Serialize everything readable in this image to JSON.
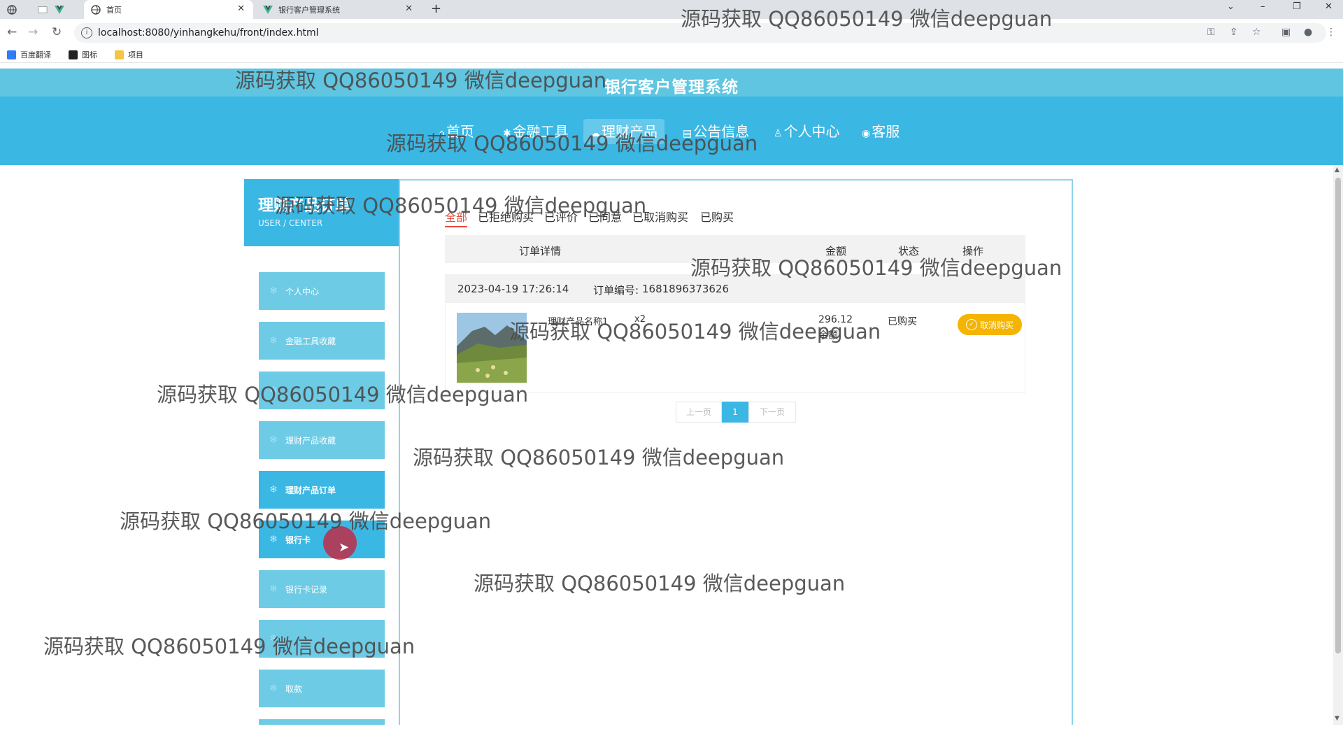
{
  "browser": {
    "tabs": [
      {
        "label": "首页",
        "active": true
      },
      {
        "label": "银行客户管理系统",
        "active": false
      }
    ],
    "new_tab_symbol": "+",
    "url": "localhost:8080/yinhangkehu/front/index.html",
    "bookmarks": [
      "百度翻译",
      "图标",
      "项目"
    ]
  },
  "site": {
    "title": "银行客户管理系统",
    "nav": [
      {
        "icon": "home-icon",
        "glyph": "⌂",
        "label": "首页"
      },
      {
        "icon": "tool-icon",
        "glyph": "✱",
        "label": "金融工具"
      },
      {
        "icon": "cloud-icon",
        "glyph": "☁",
        "label": "理财产品",
        "active": true
      },
      {
        "icon": "notice-icon",
        "glyph": "▤",
        "label": "公告信息"
      },
      {
        "icon": "user-icon",
        "glyph": "♙",
        "label": "个人中心"
      },
      {
        "icon": "service-icon",
        "glyph": "◉",
        "label": "客服"
      }
    ]
  },
  "sidebar": {
    "title": "理财产品订单",
    "subtitle": "USER / CENTER",
    "items": [
      {
        "label": "个人中心"
      },
      {
        "label": "金融工具收藏"
      },
      {
        "label": ""
      },
      {
        "label": "理财产品收藏"
      },
      {
        "label": "理财产品订单",
        "active": true
      },
      {
        "label": "银行卡"
      },
      {
        "label": "银行卡记录"
      },
      {
        "label": ""
      },
      {
        "label": "取款"
      }
    ]
  },
  "orders": {
    "filter_tabs": [
      "全部",
      "已拒绝购买",
      "已评价",
      "已同意",
      "已取消购买",
      "已购买"
    ],
    "active_filter": "全部",
    "columns": {
      "detail": "订单详情",
      "amount": "金额",
      "status": "状态",
      "action": "操作"
    },
    "list": [
      {
        "time": "2023-04-19 17:26:14",
        "order_no_label": "订单编号:",
        "order_no": "1681896373626",
        "product_name": "理财产品名称1",
        "quantity": "x2",
        "amount": "296.12",
        "pay_method": "余额",
        "status": "已购买",
        "action_label": "取消购买"
      }
    ],
    "pagination": {
      "prev": "上一页",
      "current": "1",
      "next": "下一页"
    }
  },
  "watermark": "源码获取 QQ86050149 微信deepguan",
  "colors": {
    "brand": "#3bb7e4",
    "brand_light": "#6ecbe6",
    "active_filter": "#e74c3c",
    "cancel_button": "#f5b400"
  }
}
